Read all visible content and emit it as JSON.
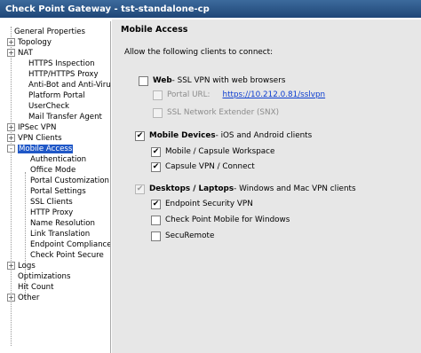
{
  "window": {
    "title": "Check Point Gateway - tst-standalone-cp"
  },
  "tree": {
    "items": [
      {
        "label": "General Properties",
        "expander": ""
      },
      {
        "label": "Topology",
        "expander": "+"
      },
      {
        "label": "NAT",
        "expander": "+"
      },
      {
        "label": "HTTPS Inspection",
        "expander": ""
      },
      {
        "label": "HTTP/HTTPS Proxy",
        "expander": ""
      },
      {
        "label": "Anti-Bot and Anti-Virus",
        "expander": ""
      },
      {
        "label": "Platform Portal",
        "expander": ""
      },
      {
        "label": "UserCheck",
        "expander": ""
      },
      {
        "label": "Mail Transfer Agent",
        "expander": ""
      },
      {
        "label": "IPSec VPN",
        "expander": "+"
      },
      {
        "label": "VPN Clients",
        "expander": "+"
      },
      {
        "label": "Mobile Access",
        "expander": "-",
        "selected": true
      },
      {
        "label": "Authentication",
        "expander": ""
      },
      {
        "label": "Office Mode",
        "expander": ""
      },
      {
        "label": "Portal Customization",
        "expander": ""
      },
      {
        "label": "Portal Settings",
        "expander": ""
      },
      {
        "label": "SSL Clients",
        "expander": ""
      },
      {
        "label": "HTTP Proxy",
        "expander": ""
      },
      {
        "label": "Name Resolution",
        "expander": ""
      },
      {
        "label": "Link Translation",
        "expander": ""
      },
      {
        "label": "Endpoint Compliance",
        "expander": ""
      },
      {
        "label": "Check Point Secure",
        "expander": ""
      },
      {
        "label": "Logs",
        "expander": "+"
      },
      {
        "label": "Optimizations",
        "expander": ""
      },
      {
        "label": "Hit Count",
        "expander": ""
      },
      {
        "label": "Other",
        "expander": "+"
      }
    ]
  },
  "panel": {
    "heading": "Mobile Access",
    "intro": "Allow the following clients to connect:",
    "web": {
      "title": "Web",
      "desc": " - SSL VPN with web browsers",
      "checked": false
    },
    "portal_url_label": "Portal URL:",
    "portal_url": "https://10.212.0.81/sslvpn",
    "snx_label": "SSL Network Extender (SNX)",
    "mobile": {
      "title": "Mobile Devices",
      "desc": " - iOS and Android clients",
      "checked": true
    },
    "mobile_workspace": "Mobile / Capsule Workspace",
    "capsule_vpn": "Capsule VPN / Connect",
    "desktops": {
      "title": "Desktops / Laptops",
      "desc": " - Windows and Mac VPN clients",
      "checked": true
    },
    "endpoint_vpn": "Endpoint Security VPN",
    "cp_mobile_windows": "Check Point Mobile for Windows",
    "securemote": "SecuRemote",
    "check_mark": "✔"
  }
}
